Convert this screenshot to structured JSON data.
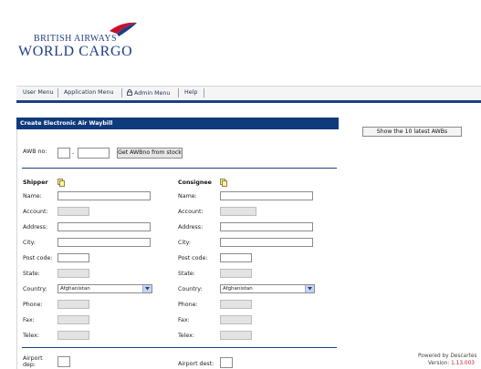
{
  "header": {
    "logo_line1": "BRITISH AIRWAYS",
    "logo_line2": "WORLD CARGO",
    "brand_red": "#c8102e",
    "brand_blue": "#1f3f82"
  },
  "menu": {
    "items": [
      {
        "label": "User Menu"
      },
      {
        "label": "Application Menu"
      },
      {
        "label": "Admin Menu",
        "icon": "lock-icon"
      },
      {
        "label": "Help"
      }
    ]
  },
  "form": {
    "title": "Create Electronic Air Waybill",
    "awb_label": "AWB no:",
    "awb_dash": "-",
    "awb_prefix": "",
    "awb_number": "",
    "get_awb_button": "Get AWBno from stock",
    "shipper": {
      "heading": "Shipper",
      "labels": {
        "name": "Name:",
        "account": "Account:",
        "address": "Address:",
        "city": "City:",
        "postcode": "Post code:",
        "state": "State:",
        "country": "Country:",
        "phone": "Phone:",
        "fax": "Fax:",
        "telex": "Telex:"
      },
      "country_value": "Afghanistan"
    },
    "consignee": {
      "heading": "Consignee",
      "labels": {
        "name": "Name:",
        "account": "Account:",
        "address": "Address:",
        "city": "City:",
        "postcode": "Post code:",
        "state": "State:",
        "country": "Country:",
        "phone": "Phone:",
        "fax": "Fax:",
        "telex": "Telex:"
      },
      "country_value": "Afghanistan"
    },
    "airport_dep_label": "Airport dep:",
    "airport_dest_label": "Airport dest:"
  },
  "side": {
    "latest_button": "Show the 10 latest AWBs",
    "powered_by": "Powered by Descartes",
    "version_label": "Version:",
    "version_value": "1.13.003"
  }
}
